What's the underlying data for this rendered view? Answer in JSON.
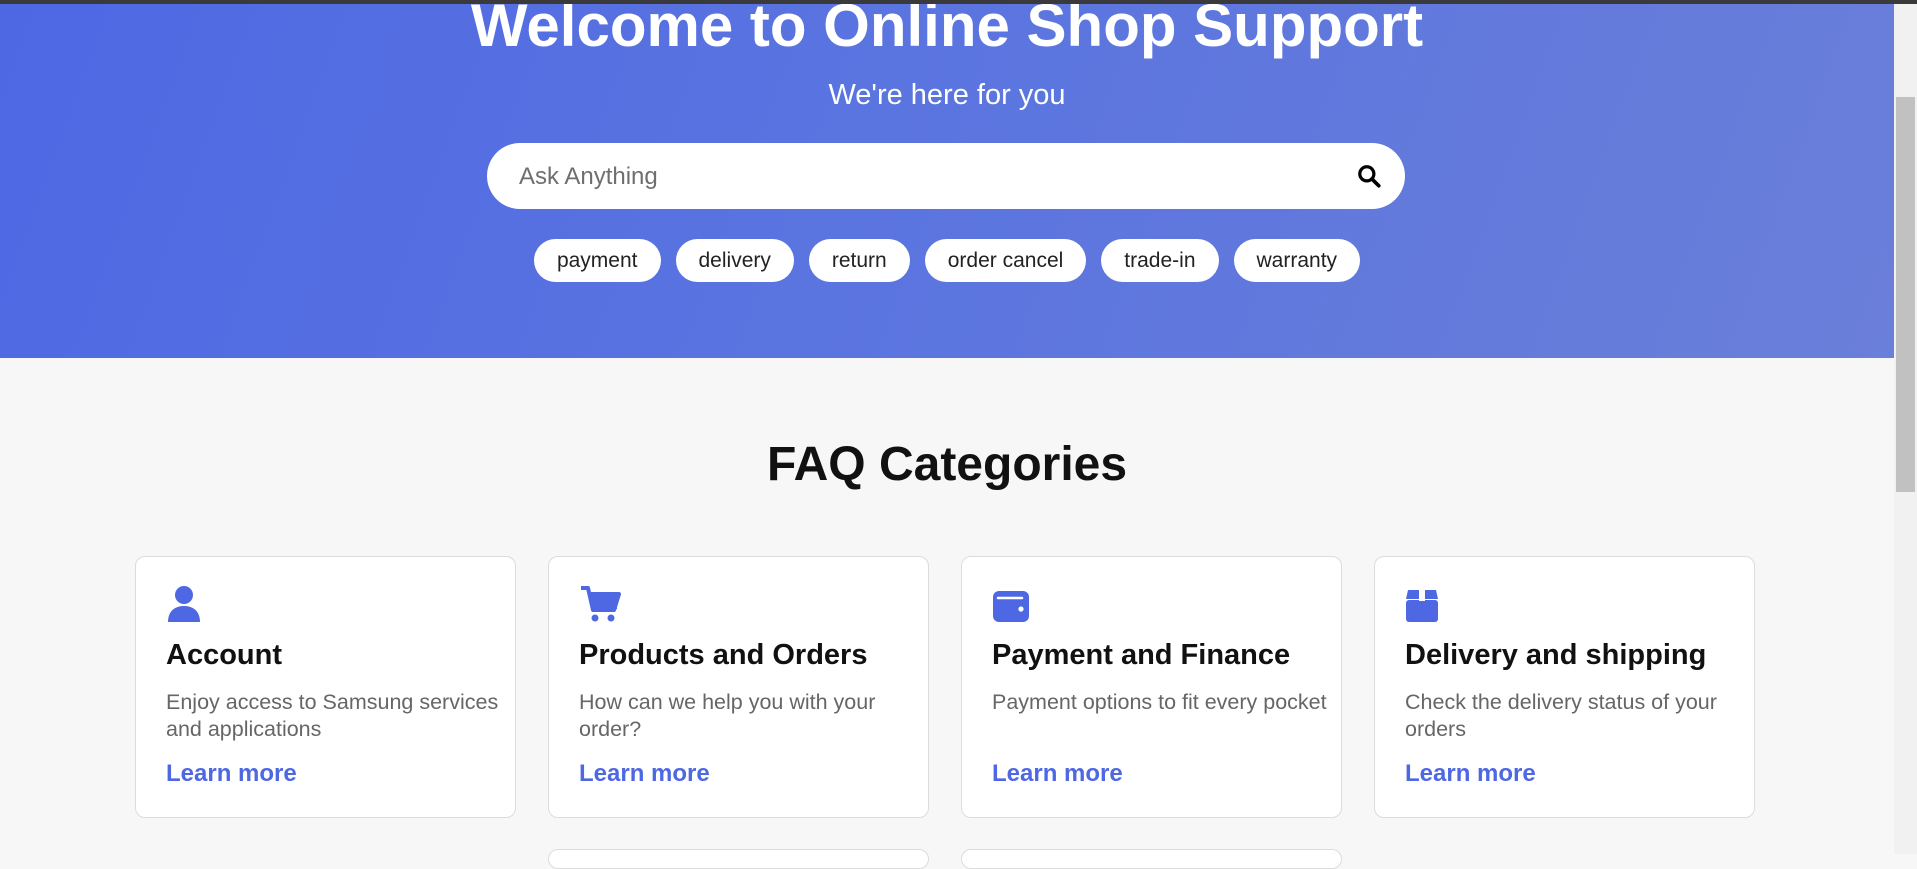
{
  "hero": {
    "title": "Welcome to Online Shop Support",
    "subtitle": "We're here for you",
    "search": {
      "placeholder": "Ask Anything",
      "value": "",
      "icon": "search-icon"
    },
    "quick_tags": [
      "payment",
      "delivery",
      "return",
      "order cancel",
      "trade-in",
      "warranty"
    ],
    "gradient": [
      "#4e68e4",
      "#6a7fd9"
    ]
  },
  "faq": {
    "title": "FAQ Categories",
    "cards": [
      {
        "icon": "user-icon",
        "title": "Account",
        "description": "Enjoy access to Samsung services and applications",
        "link": "Learn more"
      },
      {
        "icon": "cart-icon",
        "title": "Products and Orders",
        "description": "How can we help you with your order?",
        "link": "Learn more"
      },
      {
        "icon": "wallet-icon",
        "title": "Payment and Finance",
        "description": "Payment options to fit every pocket",
        "link": "Learn more"
      },
      {
        "icon": "box-icon",
        "title": "Delivery and shipping",
        "description": "Check the delivery status of your orders",
        "link": "Learn more"
      }
    ]
  },
  "colors": {
    "accent": "#4e68e4",
    "background": "#f7f7f7",
    "card": "#ffffff"
  }
}
